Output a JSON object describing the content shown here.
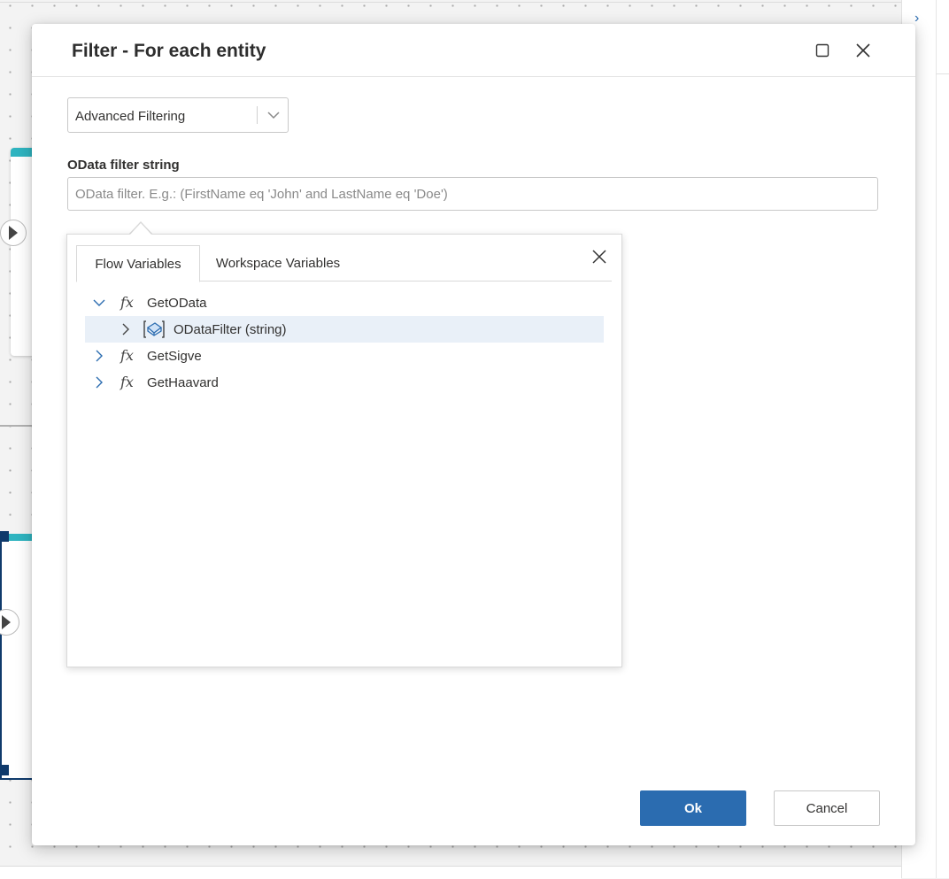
{
  "dialog": {
    "title": "Filter - For each entity",
    "maximize_icon": "maximize-icon",
    "close_icon": "close-icon"
  },
  "filter_mode": {
    "selected": "Advanced Filtering"
  },
  "odata": {
    "label": "OData filter string",
    "value": "",
    "placeholder": "OData filter. E.g.: (FirstName eq 'John' and LastName eq 'Doe')"
  },
  "variables_popup": {
    "tabs": [
      {
        "label": "Flow Variables",
        "active": true
      },
      {
        "label": "Workspace Variables",
        "active": false
      }
    ],
    "tree": [
      {
        "label": "GetOData",
        "expanded": true,
        "icon": "fx-icon",
        "children": [
          {
            "label": "ODataFilter (string)",
            "icon": "string-variable-icon",
            "selected": true
          }
        ]
      },
      {
        "label": "GetSigve",
        "expanded": false,
        "icon": "fx-icon"
      },
      {
        "label": "GetHaavard",
        "expanded": false,
        "icon": "fx-icon"
      }
    ]
  },
  "buttons": {
    "ok": "Ok",
    "cancel": "Cancel"
  },
  "colors": {
    "accent": "#2b6cb0",
    "selected_row": "#e9f0f8",
    "card_header": "#2fb4c0"
  }
}
